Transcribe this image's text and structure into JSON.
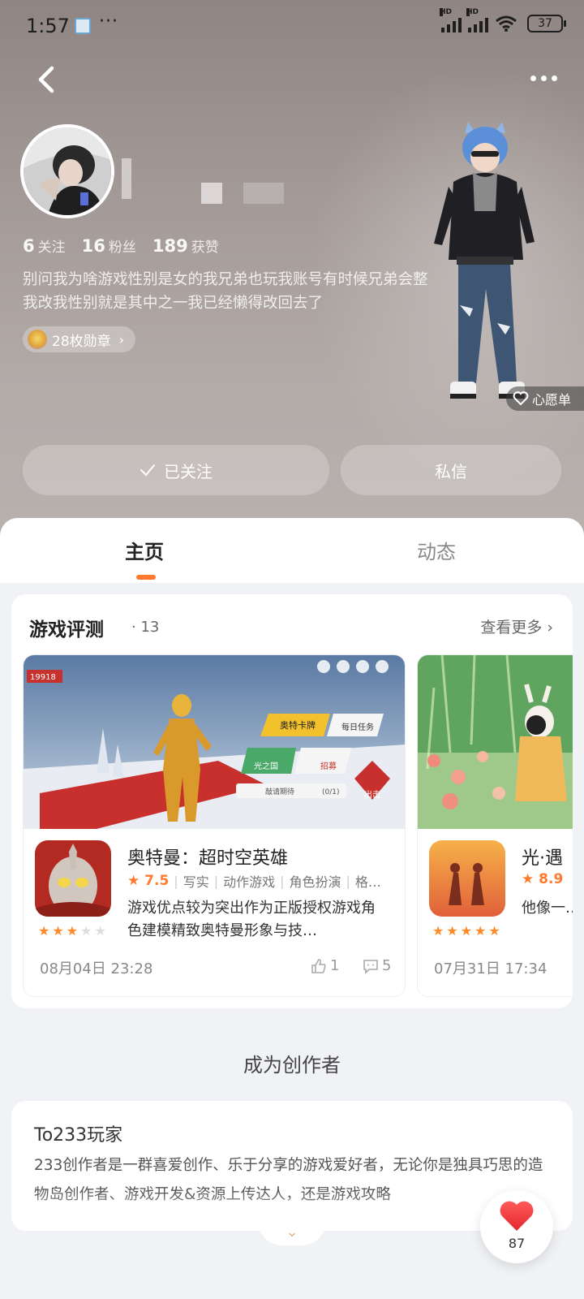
{
  "status_bar": {
    "time": "1:57",
    "overflow": "···",
    "signal1_label": "HD",
    "signal2_label": "HD",
    "battery": "37"
  },
  "profile": {
    "stats": [
      {
        "num": "6",
        "label": "关注"
      },
      {
        "num": "16",
        "label": "粉丝"
      },
      {
        "num": "189",
        "label": "获赞"
      }
    ],
    "bio": "别问我为啥游戏性别是女的我兄弟也玩我账号有时候兄弟会整我改我性别就是其中之一我已经懒得改回去了",
    "medal_label": "28枚勋章",
    "wishlist_label": "心愿单",
    "follow_label": "已关注",
    "message_label": "私信"
  },
  "tabs": {
    "home": "主页",
    "feed": "动态"
  },
  "reviews": {
    "title": "游戏评测",
    "count": "· 13",
    "more": "查看更多",
    "items": [
      {
        "name": "奥特曼：超时空英雄",
        "score": "7.5",
        "rating_stars": 3,
        "tags": [
          "写实",
          "动作游戏",
          "角色扮演",
          "格…"
        ],
        "desc": "游戏优点较为突出作为正版授权游戏角色建模精致奥特曼形象与技…",
        "time": "08月04日 23:28",
        "likes": "1",
        "comments": "5",
        "banner_texts": [
          "19918",
          "奥特卡牌",
          "每日任务",
          "光之国",
          "招募",
          "出击",
          "敲请期待",
          "(0/1)"
        ]
      },
      {
        "name": "光·遇",
        "score": "8.9",
        "rating_stars": 5,
        "desc": "他像一… 奏出的…",
        "time": "07月31日 17:34"
      }
    ]
  },
  "creator": {
    "section_title": "成为创作者",
    "card_title": "To233玩家",
    "text": "233创作者是一群喜爱创作、乐于分享的游戏爱好者，无论你是独具巧思的造物岛创作者、游戏开发&资源上传达人，还是游戏攻略"
  },
  "like_fab": {
    "count": "87"
  },
  "colors": {
    "accent": "#ff7a2f",
    "hero_bg": "#a39a97",
    "page_bg": "#f0f2f5"
  }
}
